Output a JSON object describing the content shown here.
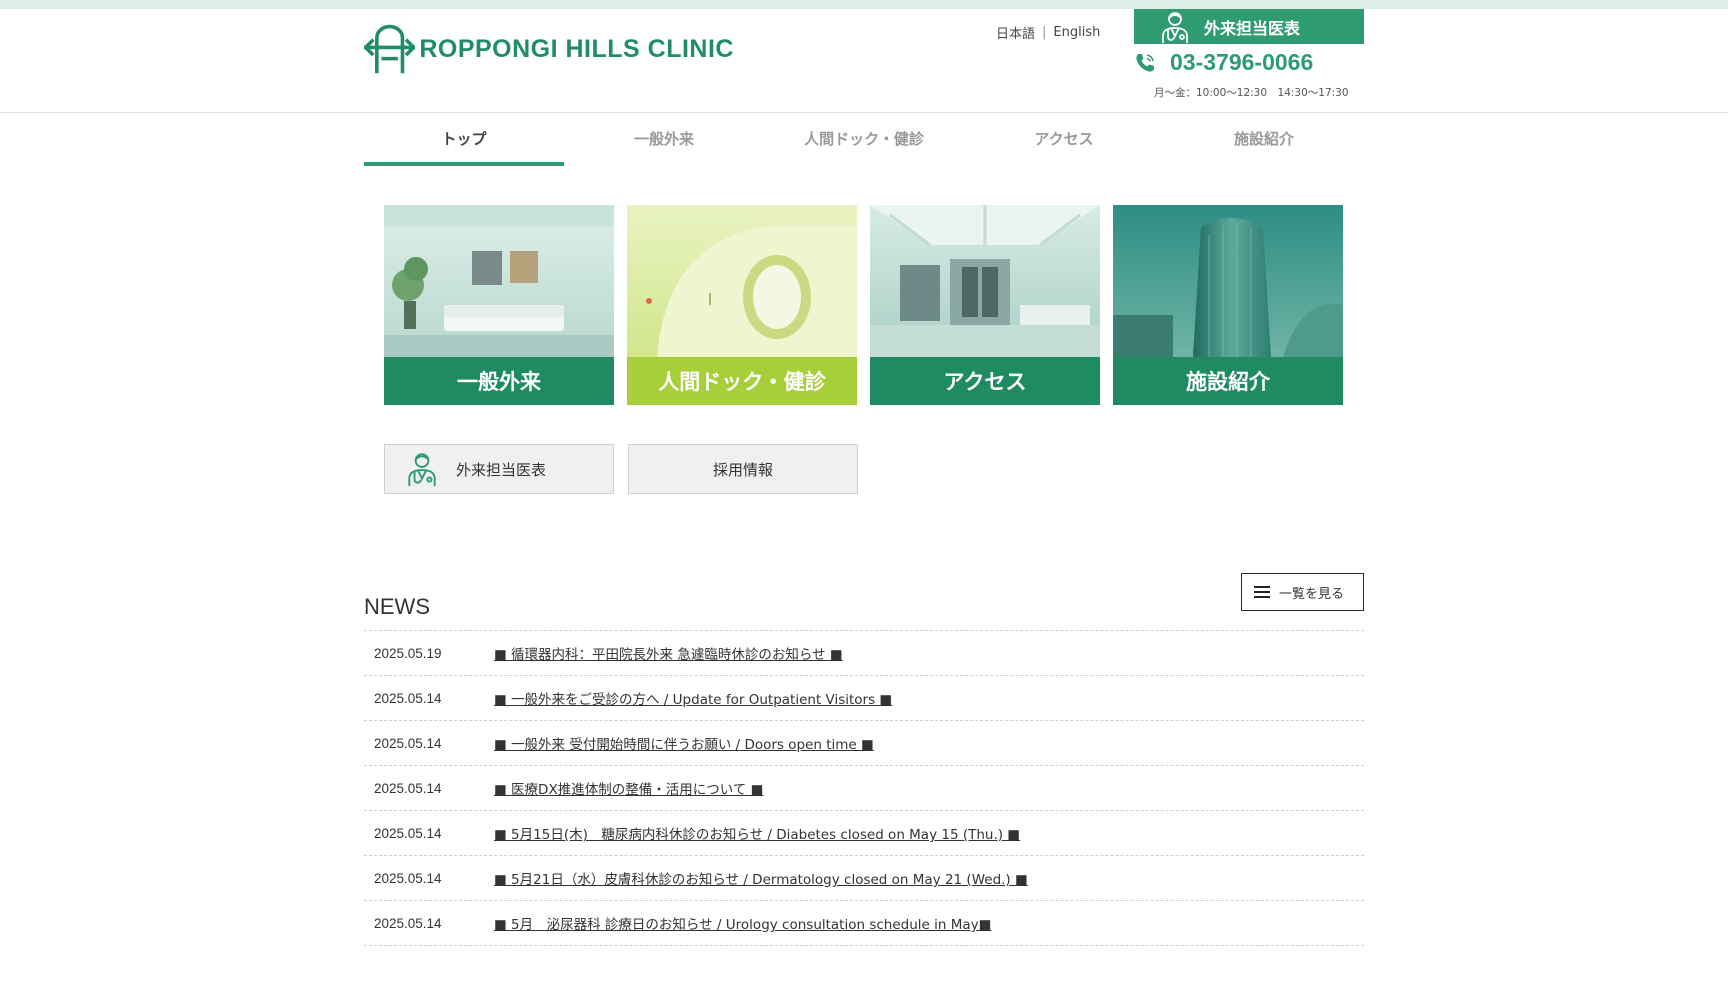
{
  "header": {
    "logo_text": "ROPPONGI HILLS CLINIC",
    "lang_jp": "日本語",
    "lang_en": "English",
    "doctor_button": "外来担当医表",
    "phone": "03-3796-0066",
    "hours": "月～金：10:00～12:30　14:30～17:30"
  },
  "nav": {
    "items": [
      {
        "label": "トップ"
      },
      {
        "label": "一般外来"
      },
      {
        "label": "人間ドック・健診"
      },
      {
        "label": "アクセス"
      },
      {
        "label": "施設紹介"
      }
    ]
  },
  "tiles": [
    {
      "label": "一般外来"
    },
    {
      "label": "人間ドック・健診"
    },
    {
      "label": "アクセス"
    },
    {
      "label": "施設紹介"
    }
  ],
  "subbuttons": {
    "doctor": "外来担当医表",
    "recruit": "採用情報"
  },
  "news": {
    "title": "NEWS",
    "more": "一覧を見る",
    "items": [
      {
        "date": "2025.05.19",
        "text": "■ 循環器内科：平田院長外来 急遽臨時休診のお知らせ ■"
      },
      {
        "date": "2025.05.14",
        "text": "■ 一般外来をご受診の方へ / Update for Outpatient Visitors ■"
      },
      {
        "date": "2025.05.14",
        "text": "■ 一般外来 受付開始時間に伴うお願い / Doors open time ■"
      },
      {
        "date": "2025.05.14",
        "text": "■ 医療DX推進体制の整備・活用について ■"
      },
      {
        "date": "2025.05.14",
        "text": "■ 5月15日(木)　糖尿病内科休診のお知らせ / Diabetes closed on May 15 (Thu.) ■"
      },
      {
        "date": "2025.05.14",
        "text": "■ 5月21日（水）皮膚科休診のお知らせ / Dermatology closed on May 21 (Wed.) ■"
      },
      {
        "date": "2025.05.14",
        "text": "■ 5月　泌尿器科 診療日のお知らせ / Urology consultation schedule in May■"
      }
    ]
  },
  "colors": {
    "brand": "#2e9b73",
    "tile_dark": "#1f8b63",
    "tile_light": "#a7cf3a"
  }
}
